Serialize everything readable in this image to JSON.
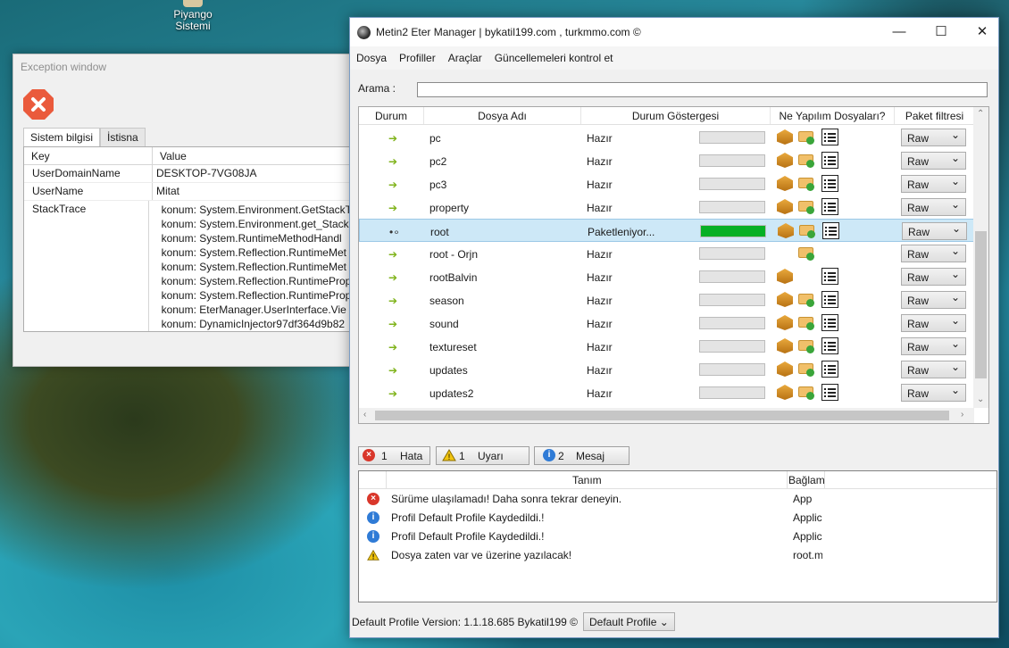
{
  "desktop": {
    "icon_label_1": "Piyango",
    "icon_label_2": "Sistemi"
  },
  "exception": {
    "title": "Exception window",
    "tabs": [
      "Sistem bilgisi",
      "İstisna"
    ],
    "headers": {
      "key": "Key",
      "value": "Value"
    },
    "rows": [
      {
        "key": "UserDomainName",
        "value": "DESKTOP-7VG08JA"
      },
      {
        "key": "UserName",
        "value": "Mitat"
      }
    ],
    "stack_key": "StackTrace",
    "stack_lines": [
      "konum: System.Environment.GetStackT",
      "konum: System.Environment.get_Stack",
      "konum: System.RuntimeMethodHandl",
      "konum: System.Reflection.RuntimeMet",
      "konum: System.Reflection.RuntimeMet",
      "konum: System.Reflection.RuntimeProp",
      "konum: System.Reflection.RuntimeProp",
      "konum: EterManager.UserInterface.Vie",
      "konum: DynamicInjector97df364d9b82"
    ]
  },
  "main": {
    "title": "Metin2 Eter Manager | bykatil199.com , turkmmo.com ©",
    "menu": [
      "Dosya",
      "Profiller",
      "Araçlar",
      "Güncellemeleri kontrol et"
    ],
    "search_label": "Arama :",
    "columns": [
      "Durum",
      "Dosya Adı",
      "Durum Göstergesi",
      "Ne Yapılım Dosyaları?",
      "Paket filtresi"
    ],
    "rows": [
      {
        "name": "pc",
        "status": "Hazır",
        "filter": "Raw",
        "progress": 0,
        "box": true,
        "boxplus": true,
        "list": true,
        "state": "arrow"
      },
      {
        "name": "pc2",
        "status": "Hazır",
        "filter": "Raw",
        "progress": 0,
        "box": true,
        "boxplus": true,
        "list": true,
        "state": "arrow"
      },
      {
        "name": "pc3",
        "status": "Hazır",
        "filter": "Raw",
        "progress": 0,
        "box": true,
        "boxplus": true,
        "list": true,
        "state": "arrow"
      },
      {
        "name": "property",
        "status": "Hazır",
        "filter": "Raw",
        "progress": 0,
        "box": true,
        "boxplus": true,
        "list": true,
        "state": "arrow"
      },
      {
        "name": "root",
        "status": "Paketleniyor...",
        "filter": "Raw",
        "progress": 1,
        "box": true,
        "boxplus": true,
        "list": true,
        "state": "busy"
      },
      {
        "name": "root - Orjn",
        "status": "Hazır",
        "filter": "Raw",
        "progress": 0,
        "box": false,
        "boxplus": true,
        "list": false,
        "state": "arrow"
      },
      {
        "name": "rootBalvin",
        "status": "Hazır",
        "filter": "Raw",
        "progress": 0,
        "box": true,
        "boxplus": false,
        "list": true,
        "state": "arrow"
      },
      {
        "name": "season",
        "status": "Hazır",
        "filter": "Raw",
        "progress": 0,
        "box": true,
        "boxplus": true,
        "list": true,
        "state": "arrow"
      },
      {
        "name": "sound",
        "status": "Hazır",
        "filter": "Raw",
        "progress": 0,
        "box": true,
        "boxplus": true,
        "list": true,
        "state": "arrow"
      },
      {
        "name": "textureset",
        "status": "Hazır",
        "filter": "Raw",
        "progress": 0,
        "box": true,
        "boxplus": true,
        "list": true,
        "state": "arrow"
      },
      {
        "name": "updates",
        "status": "Hazır",
        "filter": "Raw",
        "progress": 0,
        "box": true,
        "boxplus": true,
        "list": true,
        "state": "arrow"
      },
      {
        "name": "updates2",
        "status": "Hazır",
        "filter": "Raw",
        "progress": 0,
        "box": true,
        "boxplus": true,
        "list": true,
        "state": "arrow"
      }
    ],
    "filters": {
      "error_count": "1",
      "error_label": "Hata",
      "warning_count": "1",
      "warning_label": "Uyarı",
      "info_count": "2",
      "info_label": "Mesaj"
    },
    "log_headers": {
      "desc": "Tanım",
      "context": "Bağlam"
    },
    "log": [
      {
        "type": "error",
        "text": "Sürüme ulaşılamadı! Daha sonra tekrar deneyin.",
        "context": "App"
      },
      {
        "type": "info",
        "text": "Profil Default Profile Kaydedildi.!",
        "context": "Applic"
      },
      {
        "type": "info",
        "text": "Profil Default Profile Kaydedildi.!",
        "context": "Applic"
      },
      {
        "type": "warning",
        "text": "Dosya zaten var ve üzerine yazılacak!",
        "context": "root.m"
      }
    ],
    "status_text": "Default Profile  Version: 1.1.18.685 Bykatil199 ©",
    "profile_selected": "Default Profile"
  },
  "colors": {
    "progress_fill": "#06b025",
    "selected_row": "#cde8f7",
    "error": "#d9372b",
    "info": "#2f7bd6",
    "warning": "#f1c40f"
  }
}
